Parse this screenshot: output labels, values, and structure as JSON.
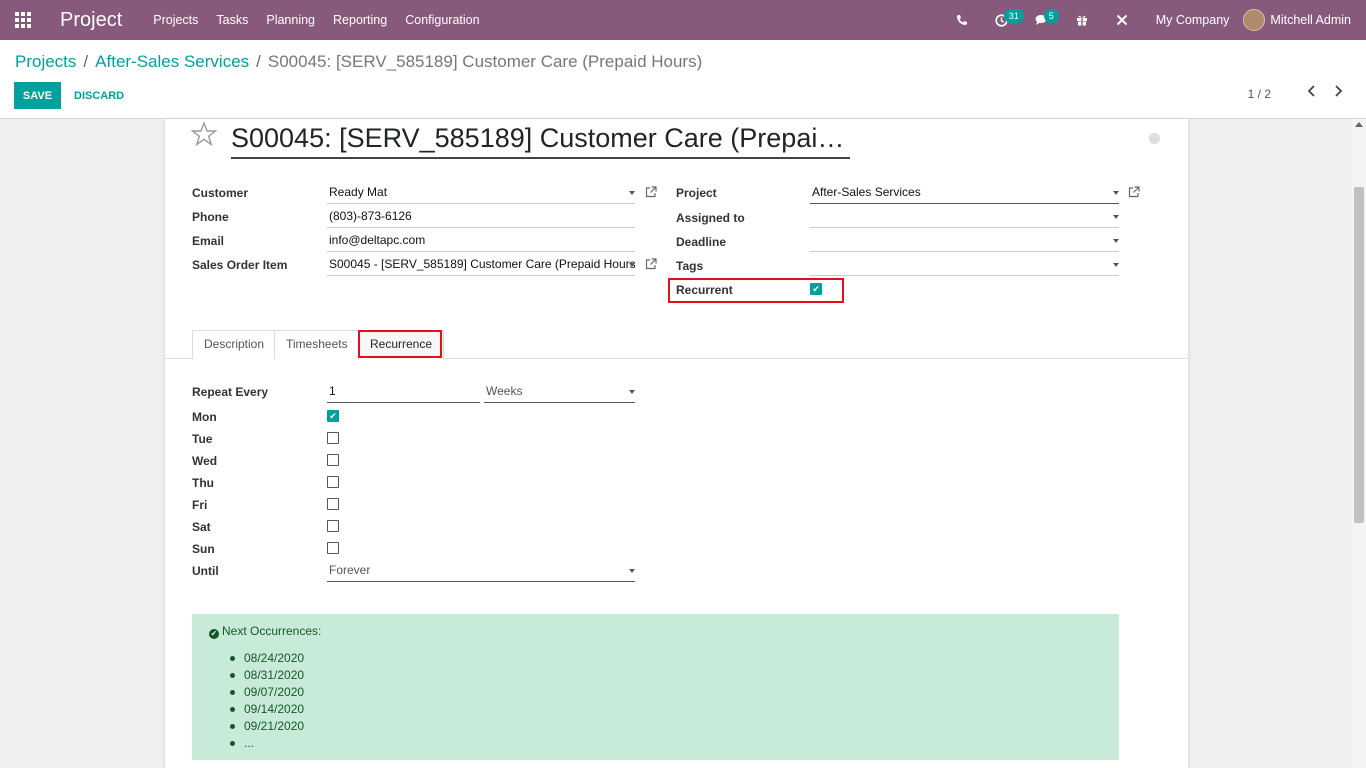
{
  "navbar": {
    "brand": "Project",
    "menu": [
      "Projects",
      "Tasks",
      "Planning",
      "Reporting",
      "Configuration"
    ],
    "activities_count": "31",
    "messages_count": "5",
    "company": "My Company",
    "user": "Mitchell Admin",
    "icons": [
      "apps-icon",
      "phone-icon",
      "clock-icon",
      "chat-icon",
      "gift-icon",
      "tools-icon"
    ]
  },
  "breadcrumb": {
    "items": [
      "Projects",
      "After-Sales Services"
    ],
    "active": "S00045: [SERV_585189] Customer Care (Prepaid Hours)",
    "separator": "/"
  },
  "toolbar": {
    "save_label": "SAVE",
    "discard_label": "DISCARD"
  },
  "pager": {
    "text": "1 / 2"
  },
  "form": {
    "title": "S00045: [SERV_585189] Customer Care (Prepai…",
    "left_fields": [
      {
        "label": "Customer",
        "value": "Ready Mat"
      },
      {
        "label": "Phone",
        "value": "(803)-873-6126"
      },
      {
        "label": "Email",
        "value": "info@deltapc.com"
      },
      {
        "label": "Sales Order Item",
        "value": "S00045 - [SERV_585189] Customer Care (Prepaid Hours)"
      }
    ],
    "right_fields": [
      {
        "label": "Project",
        "value": "After-Sales Services"
      },
      {
        "label": "Assigned to",
        "value": ""
      },
      {
        "label": "Deadline",
        "value": ""
      },
      {
        "label": "Tags",
        "value": ""
      },
      {
        "label": "Recurrent",
        "checked": true
      }
    ]
  },
  "tabs": [
    {
      "label": "Description"
    },
    {
      "label": "Timesheets"
    },
    {
      "label": "Recurrence",
      "active": true
    }
  ],
  "recurrence": {
    "repeat_label": "Repeat Every",
    "repeat_value": "1",
    "repeat_unit": "Weeks",
    "days": [
      {
        "label": "Mon",
        "checked": true
      },
      {
        "label": "Tue",
        "checked": false
      },
      {
        "label": "Wed",
        "checked": false
      },
      {
        "label": "Thu",
        "checked": false
      },
      {
        "label": "Fri",
        "checked": false
      },
      {
        "label": "Sat",
        "checked": false
      },
      {
        "label": "Sun",
        "checked": false
      }
    ],
    "until_label": "Until",
    "until_value": "Forever"
  },
  "next_occurrences": {
    "title": "Next Occurrences:",
    "dates": [
      "08/24/2020",
      "08/31/2020",
      "09/07/2020",
      "09/14/2020",
      "09/21/2020",
      "..."
    ]
  },
  "colors": {
    "navbar": "#875a7b",
    "primary": "#00a09d",
    "highlight": "#e0101c",
    "success_bg": "#c8ebd9"
  }
}
